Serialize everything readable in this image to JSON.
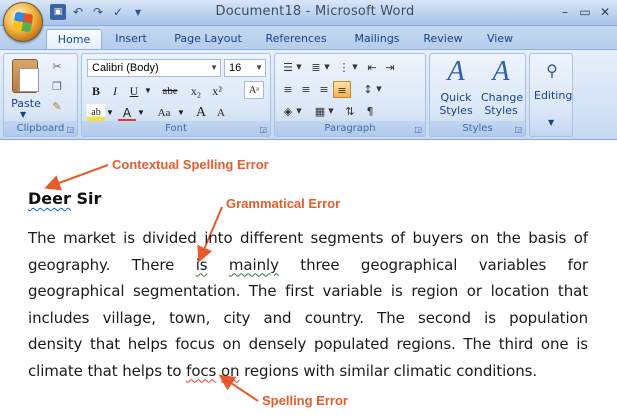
{
  "window": {
    "title": "Document18 - Microsoft Word",
    "controls": [
      "–",
      "▭",
      "✕"
    ]
  },
  "quick_access": [
    "save-icon",
    "undo-icon",
    "redo-icon",
    "check-icon",
    "customize-icon"
  ],
  "tabs": [
    {
      "label": "Home",
      "active": true
    },
    {
      "label": "Insert"
    },
    {
      "label": "Page Layout"
    },
    {
      "label": "References"
    },
    {
      "label": "Mailings"
    },
    {
      "label": "Review"
    },
    {
      "label": "View"
    }
  ],
  "ribbon": {
    "clipboard": {
      "label": "Clipboard",
      "paste_label": "Paste"
    },
    "font": {
      "label": "Font",
      "family": "Calibri (Body)",
      "size": "16",
      "bold": "B",
      "italic": "I",
      "underline": "U",
      "strike": "abe",
      "subscript": "x₂",
      "superscript": "x²",
      "change_case": "Aa",
      "grow": "A",
      "shrink": "A"
    },
    "paragraph": {
      "label": "Paragraph"
    },
    "styles": {
      "label": "Styles",
      "quick_styles": "Quick Styles",
      "change_styles": "Change Styles"
    },
    "editing": {
      "label": "Editing"
    }
  },
  "document": {
    "heading_words": [
      "Deer",
      "Sir"
    ],
    "lines": [
      "The market is divided into different segments of buyers on the basis of",
      [
        "geography.",
        "There",
        "is",
        "mainly",
        "three",
        "geographical",
        "variables",
        "for"
      ],
      "geographical segmentation. The first variable is region or location that",
      "includes village, town, city and country. The second is population",
      "density that helps focus on densely populated regions. The third one is",
      [
        "climate that helps to",
        "focs",
        "on",
        "regions with similar climatic conditions."
      ]
    ]
  },
  "annotations": {
    "contextual": "Contextual Spelling Error",
    "grammatical": "Grammatical Error",
    "spelling": "Spelling Error",
    "color": "#e65c2c"
  }
}
